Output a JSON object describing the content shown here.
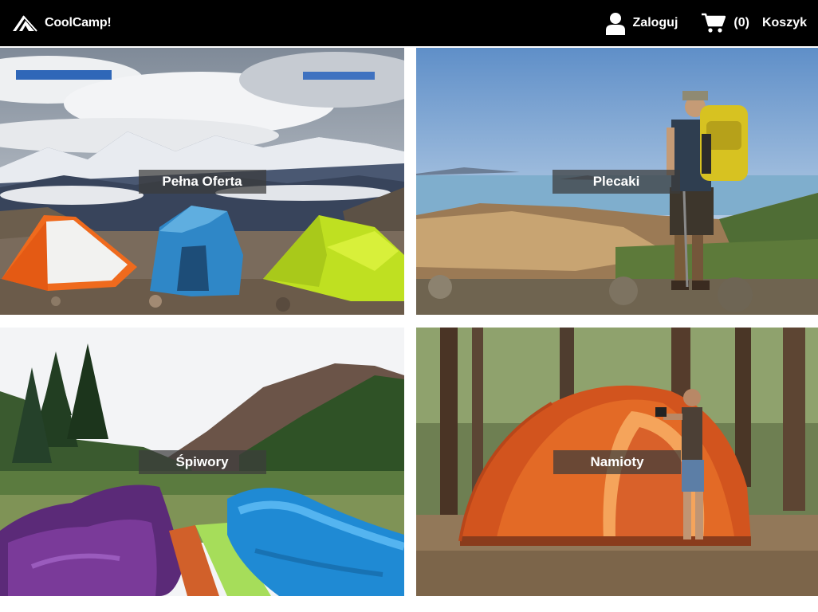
{
  "header": {
    "brand": {
      "name": "CoolCamp!",
      "icon": "tent-logo-icon"
    },
    "login_label": "Zaloguj",
    "login_icon": "user-icon",
    "cart_count": "(0)",
    "cart_label": "Koszyk",
    "cart_icon": "cart-icon"
  },
  "categories": [
    {
      "label": "Pełna Oferta"
    },
    {
      "label": "Plecaki"
    },
    {
      "label": "Śpiwory"
    },
    {
      "label": "Namioty"
    }
  ],
  "colors": {
    "header_bg": "#000000",
    "label_bg": "#3c3c3c",
    "text": "#ffffff"
  }
}
